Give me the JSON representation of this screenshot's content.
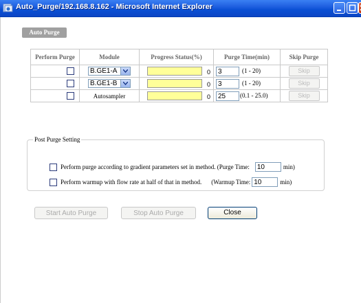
{
  "window": {
    "title": "Auto_Purge/192.168.8.162 - Microsoft Internet Explorer",
    "titlebar_color": "#0a4fd4"
  },
  "section": {
    "label": "Auto Purge"
  },
  "table": {
    "headers": [
      "Perform Purge",
      "Module",
      "Progress Status(%)",
      "Purge Time(min)",
      "Skip Purge"
    ],
    "rows": [
      {
        "module": "B.GE1-A",
        "module_type": "select",
        "progress": "0",
        "purge_time": "3",
        "range": "(1 - 20)",
        "skip": "Skip"
      },
      {
        "module": "B.GE1-B",
        "module_type": "select",
        "progress": "0",
        "purge_time": "3",
        "range": "(1 - 20)",
        "skip": "Skip"
      },
      {
        "module": "Autosampler",
        "module_type": "text",
        "progress": "0",
        "purge_time": "25",
        "range": "(0.1 - 25.0)",
        "skip": "Skip"
      }
    ]
  },
  "post_purge": {
    "legend": "Post Purge Setting",
    "gradient_label": "Perform purge according to gradient parameters set in method. (Purge Time:",
    "gradient_value": "10",
    "gradient_unit": "min)",
    "warmup_label": "Perform warmup with flow rate at half of that in method.",
    "warmup_time_label": "(Warmup Time:",
    "warmup_value": "10",
    "warmup_unit": "min)"
  },
  "buttons": {
    "start": "Start Auto Purge",
    "stop": "Stop Auto Purge",
    "close": "Close"
  },
  "colors": {
    "progress_fill": "#ffff99",
    "section_tab": "#a0a0a0",
    "disabled_text": "#aaaaaa"
  }
}
